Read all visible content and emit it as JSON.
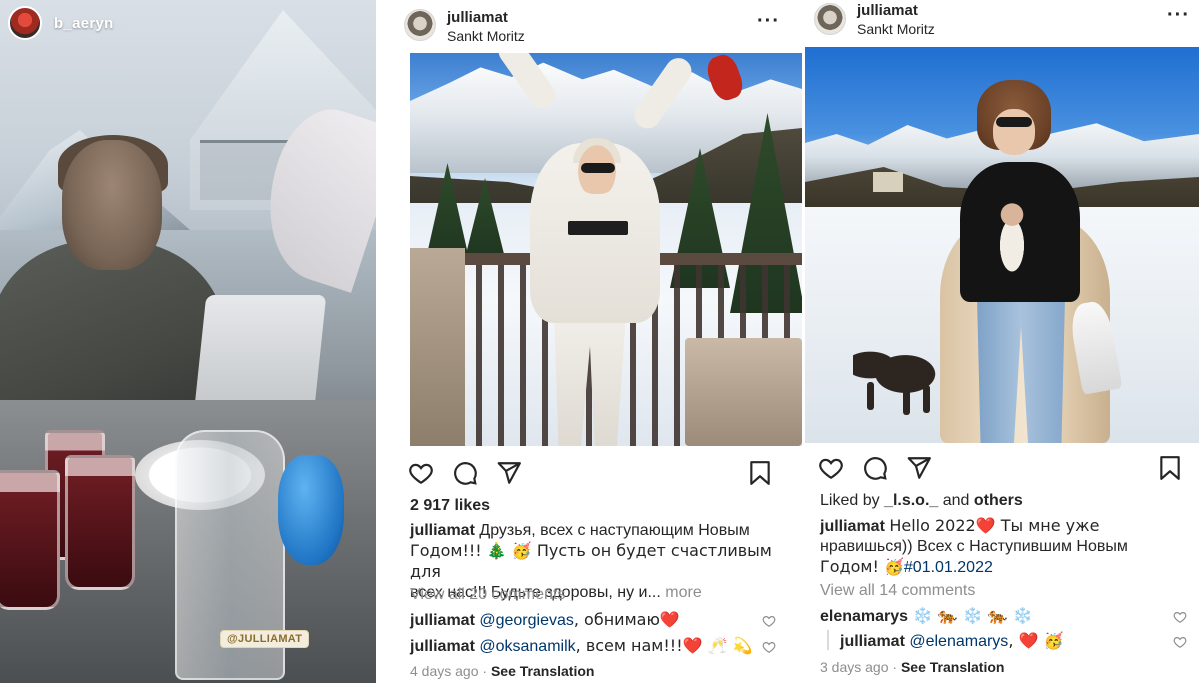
{
  "story": {
    "username": "b_aeryn",
    "tag_sticker": "@JULLIAMAT"
  },
  "post1": {
    "username": "julliamat",
    "location": "Sankt Moritz",
    "likes": "2 917 likes",
    "caption": {
      "username": "julliamat",
      "line1": "Друзья, всех с наступающим Новым",
      "line2": "Годом!!! 🎄 🥳 Пусть он будет счастливым для",
      "line3": "всех нас!!! Будьте здоровы, ну и...",
      "more": "more"
    },
    "view_comments": "View all 20 comments",
    "comments": [
      {
        "username": "julliamat",
        "mention": "@georgievas",
        "text": ", обнимаю❤️"
      },
      {
        "username": "julliamat",
        "mention": "@oksanamilk",
        "text": ", всем нам!!!❤️ 🥂 💫"
      }
    ],
    "time": "4 days ago",
    "translation": "See Translation"
  },
  "post2": {
    "username": "julliamat",
    "location": "Sankt Moritz",
    "liked_by_prefix": "Liked by",
    "liked_by_user": "_l.s.o._",
    "liked_by_and": "and",
    "liked_by_others": "others",
    "caption": {
      "username": "julliamat",
      "line1": "Hello 2022❤️  Ты мне уже",
      "line2": "нравишься)) Всех с Наступившим Новым",
      "line3_text": "Годом! 🥳",
      "line3_tag": "#01.01.2022"
    },
    "view_comments": "View all 14 comments",
    "comments": [
      {
        "username": "elenamarys",
        "mention": "",
        "text": "❄️ 🐅 ❄️ 🐅 ❄️"
      },
      {
        "username": "julliamat",
        "mention": "@elenamarys",
        "text": ", ❤️ 🥳"
      }
    ],
    "time": "3 days ago",
    "translation": "See Translation"
  },
  "icons": [
    "heart-icon",
    "comment-icon",
    "share-icon",
    "bookmark-icon",
    "more-icon",
    "small-heart-icon"
  ],
  "colors": {
    "text": "#262626",
    "muted": "#8e8e8e",
    "link": "#00376b"
  }
}
